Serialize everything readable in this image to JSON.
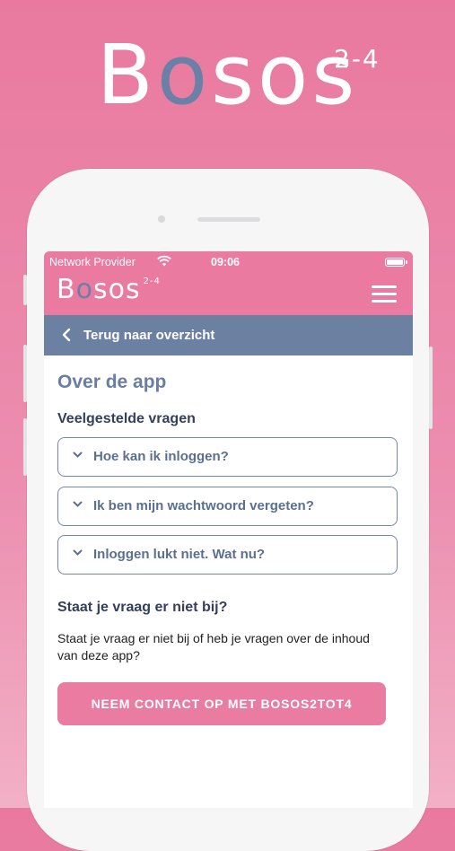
{
  "hero": {
    "logo_b": "B",
    "logo_o": "o",
    "logo_rest": "sos",
    "logo_sup": "2-4"
  },
  "status_bar": {
    "carrier": "Network Provider",
    "time": "09:06"
  },
  "app_header": {
    "logo_b": "B",
    "logo_o": "o",
    "logo_rest": "sos",
    "logo_sup": "2-4"
  },
  "back_nav": {
    "label": "Terug naar overzicht"
  },
  "page": {
    "title": "Over de app",
    "faq_title": "Veelgestelde vragen",
    "faq_items": [
      {
        "label": "Hoe kan ik inloggen?"
      },
      {
        "label": "Ik ben mijn wachtwoord vergeten?"
      },
      {
        "label": "Inloggen lukt niet. Wat nu?"
      }
    ],
    "not_found_title": "Staat je vraag er niet bij?",
    "not_found_text": "Staat je vraag er niet bij of heb je vragen over de inhoud van deze app?",
    "contact_button": "NEEM CONTACT OP MET BOSOS2TOT4"
  },
  "colors": {
    "pink": "#ea7aa0",
    "blue_gray": "#6c80a1",
    "title_blue": "#6a7ea3",
    "logo_o": "#6a80a7"
  }
}
